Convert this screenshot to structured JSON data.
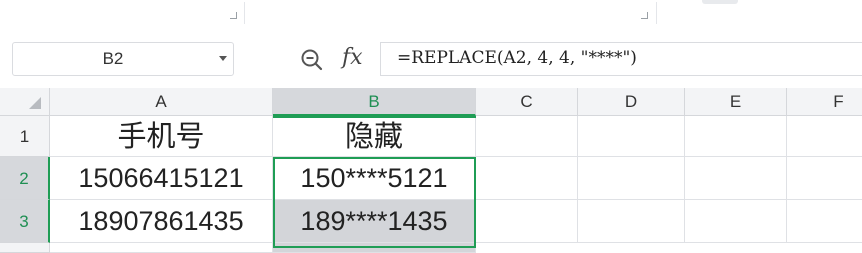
{
  "name_box": {
    "value": "B2"
  },
  "formula_bar": {
    "fx_label": "fx",
    "formula": "=REPLACE(A2, 4, 4, \"****\")"
  },
  "columns": [
    "A",
    "B",
    "C",
    "D",
    "E",
    "F"
  ],
  "rows": [
    "1",
    "2",
    "3"
  ],
  "cells": {
    "A1": "手机号",
    "B1": "隐藏",
    "A2": "15066415121",
    "B2": "150****5121",
    "A3": "18907861435",
    "B3": "189****1435"
  },
  "colors": {
    "selection": "#1f9d55",
    "header_bg": "#f3f4f6",
    "header_selected_bg": "#d6d8dc"
  },
  "icons": [
    "zoom-formula-icon",
    "dropdown-arrow-icon",
    "select-all-icon"
  ]
}
